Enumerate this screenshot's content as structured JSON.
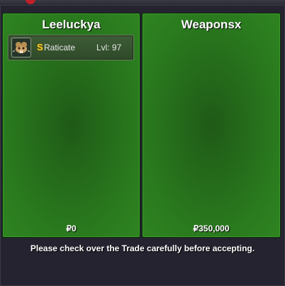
{
  "trade": {
    "left": {
      "title": "Leeluckya",
      "money": "₽0",
      "pokemon": [
        {
          "shiny": "S",
          "name": "Raticate",
          "level": "Lvl: 97"
        }
      ]
    },
    "right": {
      "title": "Weaponsx",
      "money": "₽350,000",
      "pokemon": []
    },
    "note": "Please check over the Trade carefully before accepting."
  },
  "colors": {
    "panel_green": "#2a7a1e",
    "shiny_gold": "#ffd21f",
    "background": "#1f1f2b"
  },
  "icons": {
    "pokemon_icon": "raticate-icon"
  }
}
